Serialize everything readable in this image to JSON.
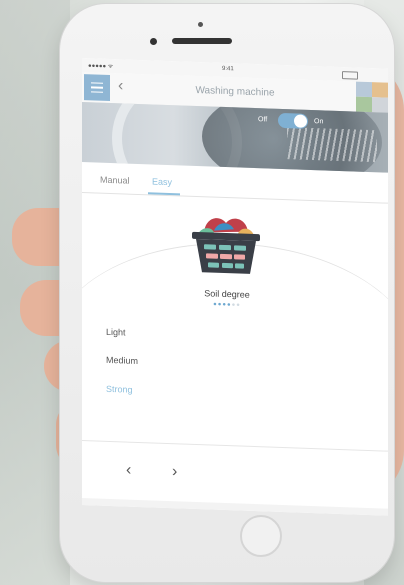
{
  "statusbar": {
    "carrier": "●●●●● ᯤ",
    "time": "9:41"
  },
  "navbar": {
    "title": "Washing machine",
    "back_icon": "‹"
  },
  "hero": {
    "toggle_off_label": "Off",
    "toggle_on_label": "On",
    "toggle_state": "on"
  },
  "tabs": [
    {
      "label": "Manual",
      "active": false
    },
    {
      "label": "Easy",
      "active": true
    }
  ],
  "soil": {
    "title": "Soil degree",
    "level": 4,
    "max": 6
  },
  "options": [
    {
      "label": "Light",
      "selected": false
    },
    {
      "label": "Medium",
      "selected": false
    },
    {
      "label": "Strong",
      "selected": true
    }
  ],
  "nav": {
    "prev": "‹",
    "next": "›"
  },
  "colors": {
    "accent": "#8fc0de",
    "menu_button": "#8fb6d4",
    "toggle": "#7fb0d3"
  },
  "icons": {
    "menu": "hamburger-menu-icon",
    "back": "chevron-left-icon",
    "basket": "laundry-basket-icon",
    "prev": "chevron-left-icon",
    "next": "chevron-right-icon"
  }
}
